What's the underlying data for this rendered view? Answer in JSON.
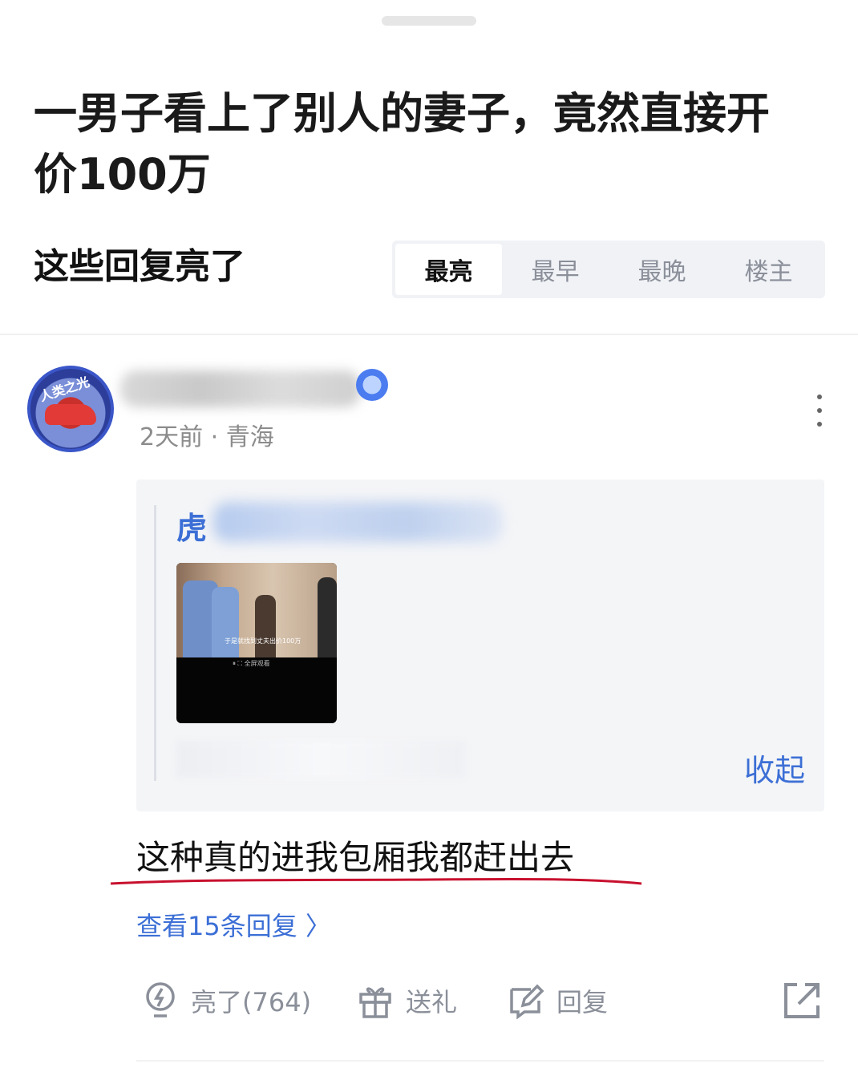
{
  "post": {
    "title": "一男子看上了别人的妻子，竟然直接开价100万"
  },
  "replies_section": {
    "title": "这些回复亮了",
    "sort_tabs": [
      {
        "label": "最亮",
        "active": true
      },
      {
        "label": "最早",
        "active": false
      },
      {
        "label": "最晚",
        "active": false
      },
      {
        "label": "楼主",
        "active": false
      }
    ]
  },
  "comment": {
    "avatar_text": "人类之光",
    "meta": "2天前 · 青海",
    "quote": {
      "author_visible": "虎",
      "video_caption": "于是就找到丈夫出价100万",
      "video_controls": "⏸  ⛶ 全屏观看",
      "collapse_label": "收起"
    },
    "text": "这种真的进我包厢我都赶出去",
    "view_replies": "查看15条回复 〉",
    "actions": {
      "like": "亮了(764)",
      "gift": "送礼",
      "reply": "回复"
    }
  },
  "icons": [
    "more-vertical-icon",
    "lightbulb-icon",
    "gift-icon",
    "edit-reply-icon",
    "share-icon"
  ],
  "colors": {
    "link_blue": "#3c6fd6",
    "muted_gray": "#8a8f99",
    "underline_red": "#c8102e"
  }
}
